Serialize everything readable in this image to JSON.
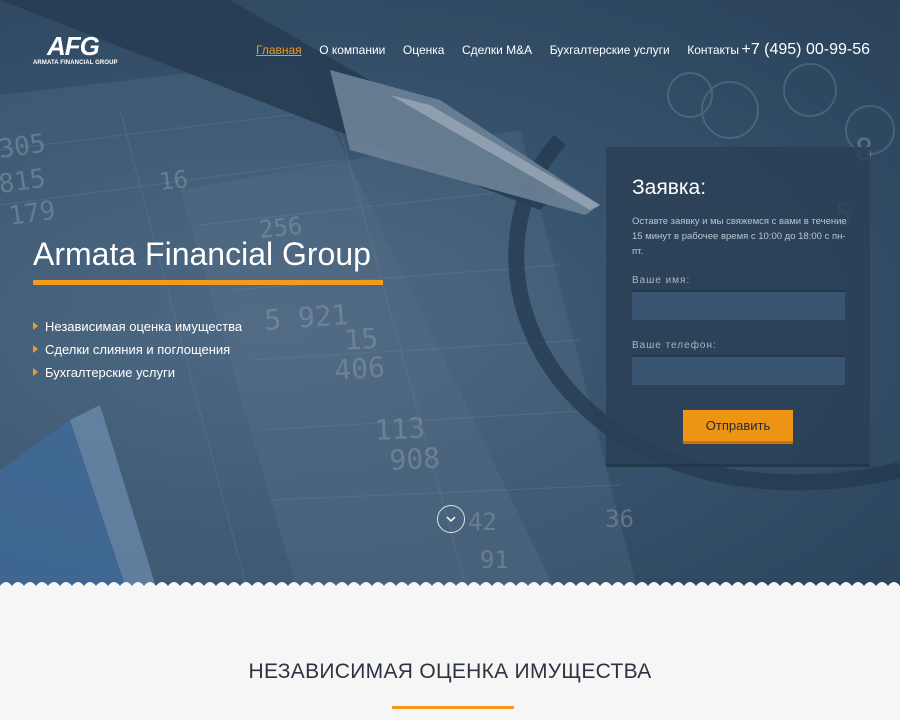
{
  "header": {
    "logo_mark": "AFG",
    "logo_subtitle": "ARMATA FINANCIAL GROUP",
    "nav": [
      {
        "label": "Главная",
        "active": true
      },
      {
        "label": "О компании",
        "active": false
      },
      {
        "label": "Оценка",
        "active": false
      },
      {
        "label": "Сделки M&A",
        "active": false
      },
      {
        "label": "Бухгалтерские услуги",
        "active": false
      },
      {
        "label": "Контакты",
        "active": false
      }
    ],
    "phone": "+7 (495) 00-99-56"
  },
  "hero": {
    "title": "Armata Financial Group",
    "features": [
      "Независимая оценка имущества",
      "Сделки слияния и поглощения",
      "Бухгалтерские услуги"
    ],
    "background_numbers": [
      "305",
      "815",
      "179",
      "16",
      "256",
      "5 921",
      "15",
      "406",
      "113",
      "908",
      "42",
      "36",
      "8",
      "5",
      "91"
    ]
  },
  "form": {
    "title": "Заявка:",
    "description": "Оставте заявку и мы свяжемся с вами в течение 15 минут в рабочее время с 10:00 до 18:00 с пн-пт.",
    "name_label": "Ваше имя:",
    "name_value": "",
    "phone_label": "Ваше телефон:",
    "phone_value": "",
    "submit_label": "Отправить"
  },
  "section": {
    "title": "НЕЗАВИСИМАЯ ОЦЕНКА ИМУЩЕСТВА"
  },
  "colors": {
    "accent": "#f29a1d",
    "hero_dark": "#2a4259",
    "form_bg": "#2a4056",
    "page_bg": "#f6f6f6",
    "heading": "#2b3440"
  },
  "icons": {
    "scroll": "chevron-down-icon",
    "feature_bullet": "triangle-right-icon"
  }
}
